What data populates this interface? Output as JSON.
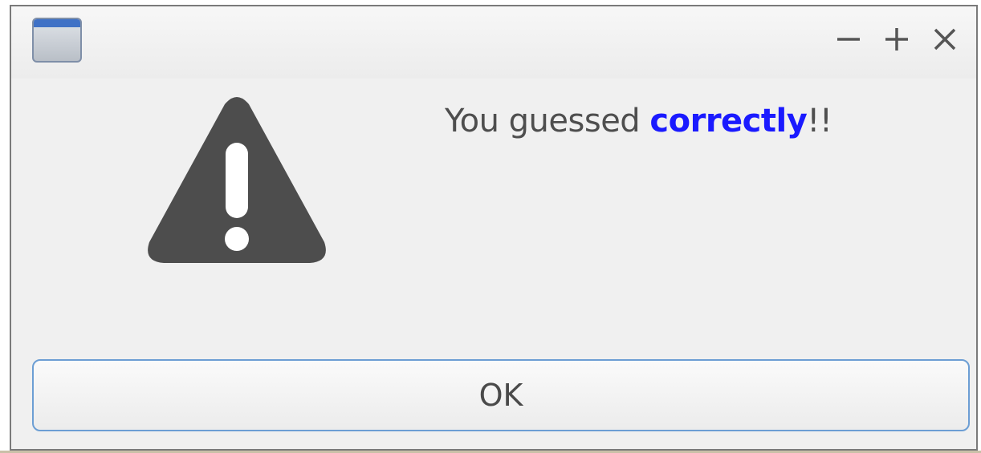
{
  "window": {
    "controls": {
      "minimize_icon": "minimize-icon",
      "maximize_icon": "maximize-icon",
      "close_icon": "close-icon"
    }
  },
  "dialog": {
    "icon": "warning-icon",
    "message_prefix": "You guessed ",
    "message_emphasis": "correctly",
    "message_suffix": "!!",
    "emphasis_color": "#1a1aff",
    "ok_label": "OK"
  }
}
